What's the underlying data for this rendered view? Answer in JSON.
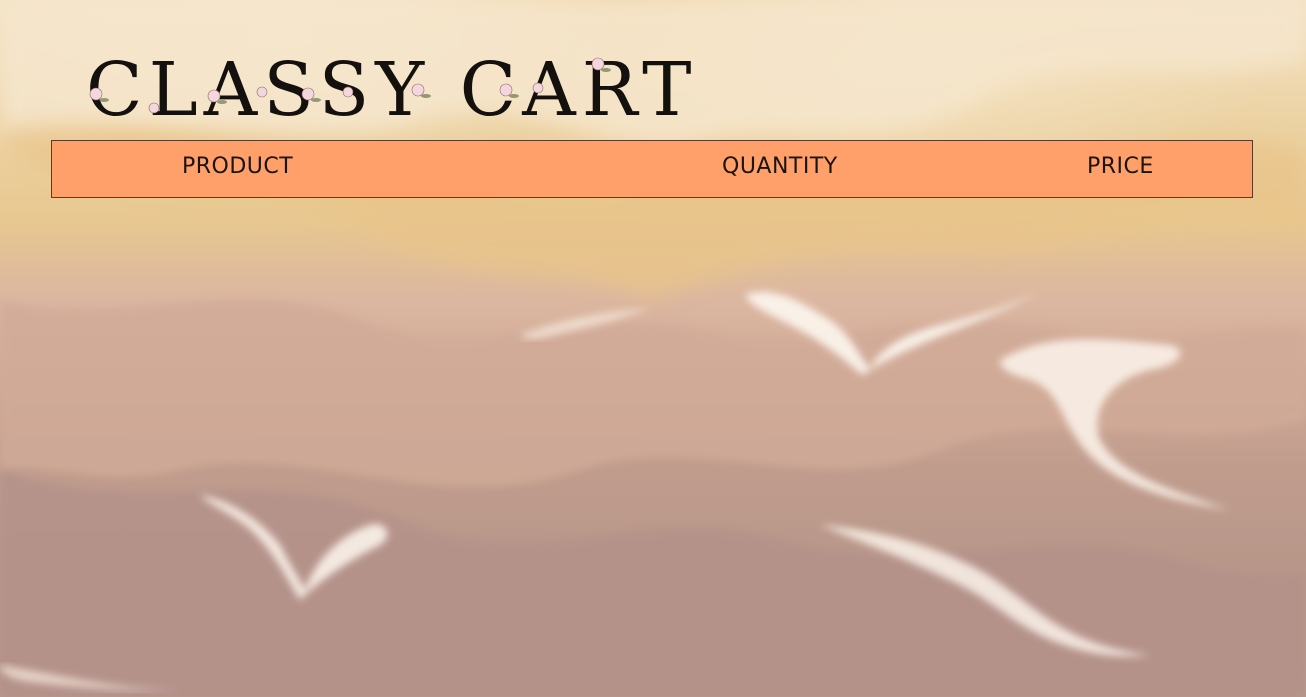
{
  "brand": {
    "logo_text": "CLASSY CART"
  },
  "cart_table": {
    "headers": {
      "product": "PRODUCT",
      "quantity": "QUANTITY",
      "price": "PRICE"
    },
    "rows": []
  },
  "colors": {
    "header_bar": "#ffa06a",
    "header_border": "#5a3a2a",
    "logo_text": "#14100e",
    "bg_cream": "#f3e2c6",
    "bg_sand": "#e8c890",
    "bg_rose": "#b8978a"
  }
}
